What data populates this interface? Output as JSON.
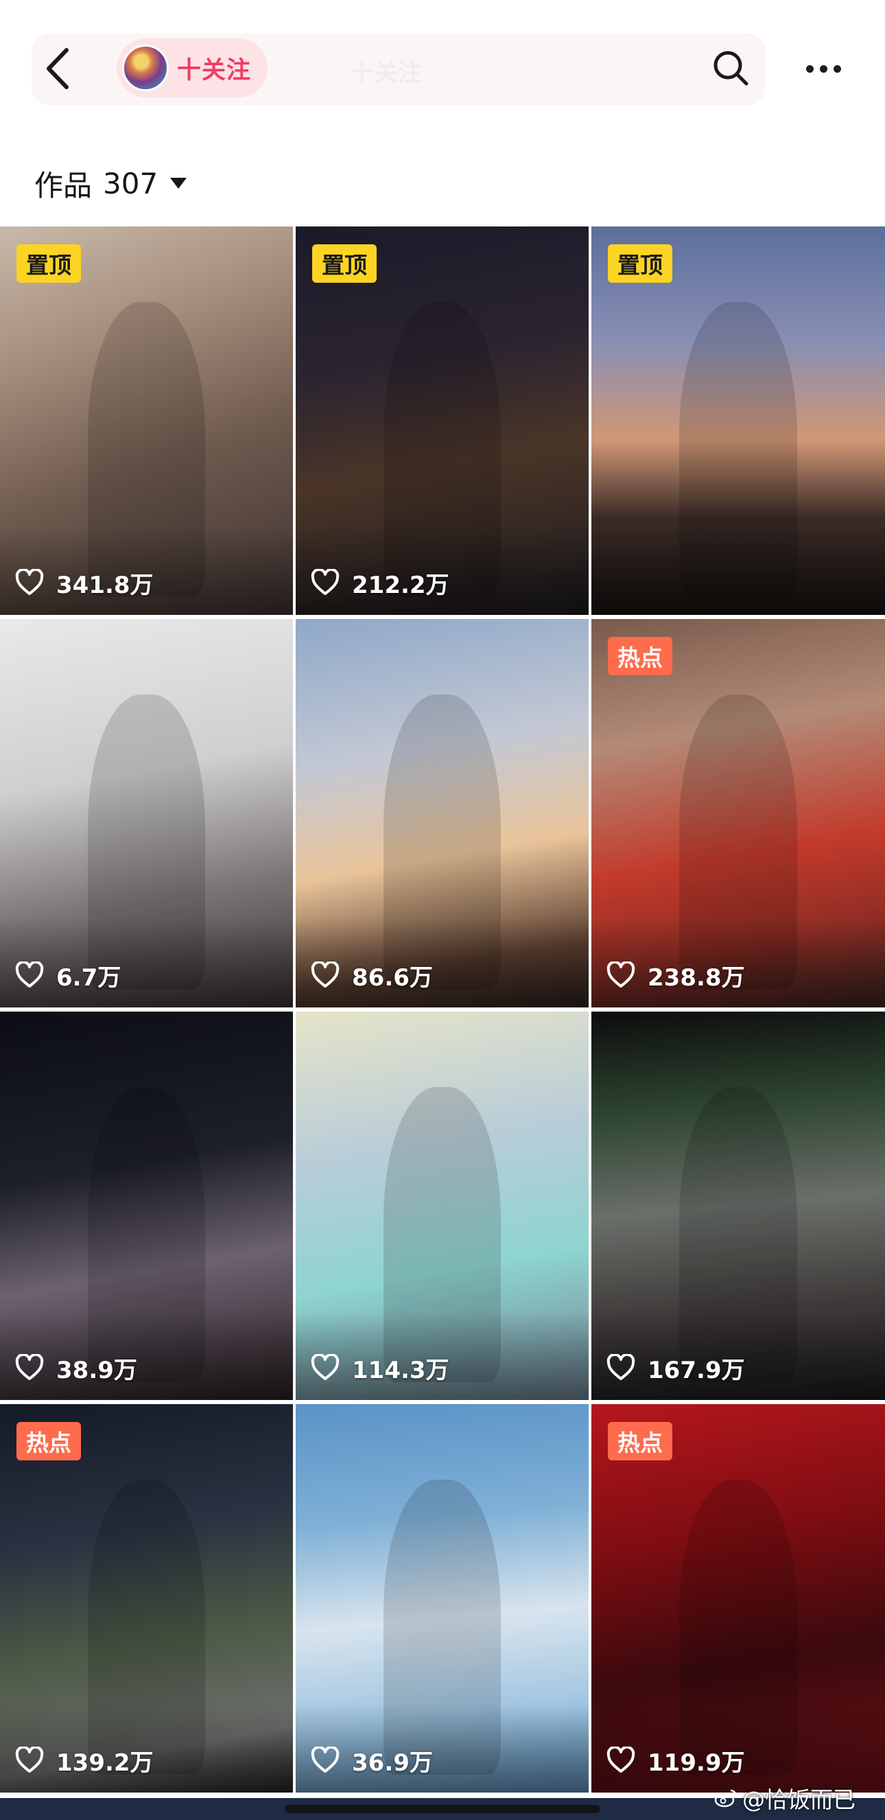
{
  "header": {
    "follow_label": "十关注",
    "ghost_label": "十关注"
  },
  "works": {
    "label": "作品",
    "count": "307"
  },
  "tiles": [
    {
      "likes": "341.8万",
      "badge": "置顶",
      "badge_type": "pin",
      "bg": "linear-gradient(160deg,#c9b9aa 0%,#a58d7c 30%,#6e5a4e 60%,#3d3230 100%)"
    },
    {
      "likes": "212.2万",
      "badge": "置顶",
      "badge_type": "pin",
      "bg": "linear-gradient(170deg,#1b1a2a 0%,#2b2430 35%,#4a3528 60%,#1c1a1e 100%)"
    },
    {
      "likes": "",
      "badge": "置顶",
      "badge_type": "pin",
      "bg": "linear-gradient(180deg,#5b6f9c 0%,#8a8fb4 30%,#d19775 55%,#3a2b26 75%,#171312 100%)"
    },
    {
      "likes": "6.7万",
      "badge": "",
      "badge_type": "",
      "bg": "linear-gradient(170deg,#e9e9ea 0%,#cfcfd1 40%,#7b7474 70%,#3b3232 100%)"
    },
    {
      "likes": "86.6万",
      "badge": "",
      "badge_type": "",
      "bg": "linear-gradient(170deg,#8fa8c8 0%,#c3c8d4 35%,#e9c49a 60%,#5b3f30 85%,#2c221d 100%)"
    },
    {
      "likes": "238.8万",
      "badge": "热点",
      "badge_type": "hot",
      "bg": "linear-gradient(170deg,#7a5a4c 0%,#b38b77 30%,#c23a2b 60%,#8e2d24 80%,#3b2420 100%)"
    },
    {
      "likes": "38.9万",
      "badge": "",
      "badge_type": "",
      "bg": "linear-gradient(170deg,#0c0d14 0%,#1d1f2a 40%,#6c6170 65%,#2a2022 100%)"
    },
    {
      "likes": "114.3万",
      "badge": "",
      "badge_type": "",
      "bg": "linear-gradient(170deg,#e6e4c8 0%,#b9cdd8 35%,#8ed4d0 65%,#6e7f8f 100%)"
    },
    {
      "likes": "167.9万",
      "badge": "",
      "badge_type": "",
      "bg": "linear-gradient(175deg,#0c0c0c 0%,#2d4430 25%,#6a6f6a 50%,#3f3b3a 75%,#1c1a1a 100%)"
    },
    {
      "likes": "139.2万",
      "badge": "热点",
      "badge_type": "hot",
      "bg": "linear-gradient(170deg,#141a26 0%,#2a3342 35%,#4b5a45 60%,#6f6f6e 85%,#232323 100%)"
    },
    {
      "likes": "36.9万",
      "badge": "",
      "badge_type": "",
      "bg": "linear-gradient(175deg,#5a93c7 0%,#7fb0d6 30%,#d8e4ee 55%,#9cc3e0 80%,#5a8cb5 100%)"
    },
    {
      "likes": "119.9万",
      "badge": "热点",
      "badge_type": "hot",
      "bg": "linear-gradient(170deg,#b4171c 0%,#7e0d12 35%,#3a0a0d 65%,#6d1016 100%)"
    }
  ],
  "watermark": "@恰饭而已"
}
